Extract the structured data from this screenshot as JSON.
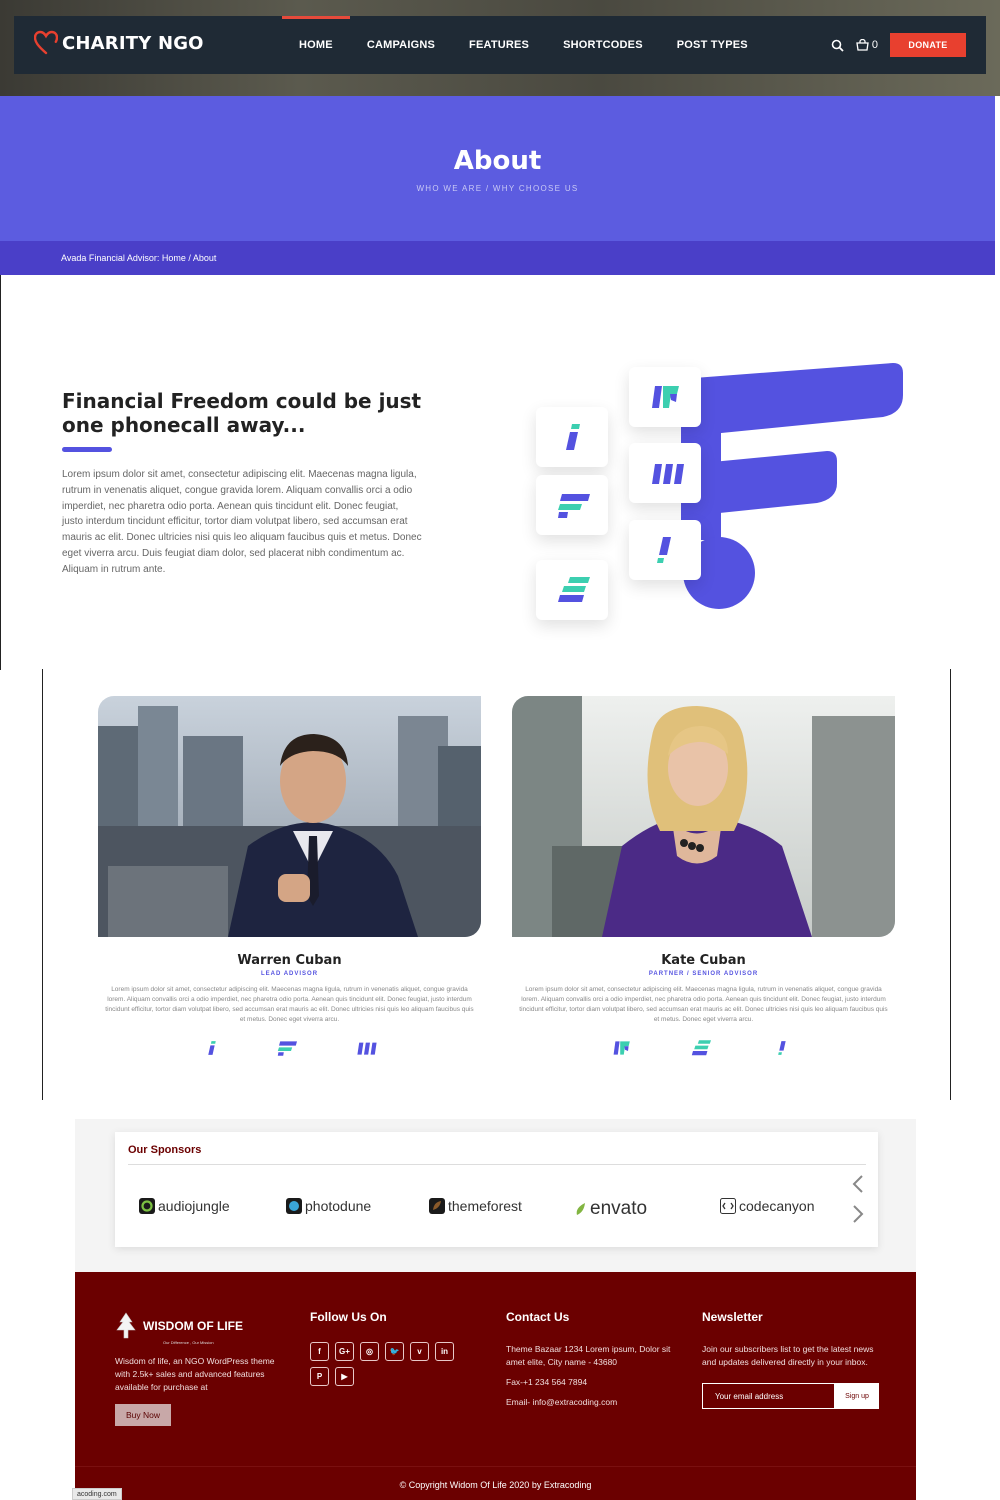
{
  "header": {
    "logo_text": "CHARITY NGO",
    "menu": [
      "HOME",
      "CAMPAIGNS",
      "FEATURES",
      "SHORTCODES",
      "POST TYPES"
    ],
    "cart_count": "0",
    "donate_label": "DONATE"
  },
  "hero": {
    "title": "About",
    "subtitle": "WHO WE ARE / WHY CHOOSE US",
    "breadcrumb": "Avada Financial Advisor: Home  /  About"
  },
  "about": {
    "heading": "Financial Freedom could be just one phonecall away...",
    "body": "Lorem ipsum dolor sit amet, consectetur adipiscing elit. Maecenas magna ligula, rutrum in venenatis aliquet, congue gravida lorem. Aliquam convallis orci a odio imperdiet, nec pharetra odio porta. Aenean quis tincidunt elit. Donec feugiat, justo interdum tincidunt efficitur, tortor diam volutpat libero, sed accumsan erat mauris ac elit. Donec ultricies nisi quis leo aliquam faucibus quis et metus. Donec eget viverra arcu. Duis feugiat diam dolor, sed placerat nibh condimentum ac. Aliquam in rutrum ante."
  },
  "team": [
    {
      "name": "Warren Cuban",
      "role": "LEAD ADVISOR",
      "bio": "Lorem ipsum dolor sit amet, consectetur adipiscing elit. Maecenas magna ligula, rutrum in venenatis aliquet, congue gravida lorem. Aliquam convallis orci a odio imperdiet, nec pharetra odio porta. Aenean quis tincidunt elit. Donec feugiat, justo interdum tincidunt efficitur, tortor diam volutpat libero, sed accumsan erat mauris ac elit. Donec ultricies nisi quis leo aliquam faucibus quis et metus. Donec eget viverra arcu."
    },
    {
      "name": "Kate Cuban",
      "role": "PARTNER / SENIOR ADVISOR",
      "bio": "Lorem ipsum dolor sit amet, consectetur adipiscing elit. Maecenas magna ligula, rutrum in venenatis aliquet, congue gravida lorem. Aliquam convallis orci a odio imperdiet, nec pharetra odio porta. Aenean quis tincidunt elit. Donec feugiat, justo interdum tincidunt efficitur, tortor diam volutpat libero, sed accumsan erat mauris ac elit. Donec ultricies nisi quis leo aliquam faucibus quis et metus. Donec eget viverra arcu."
    }
  ],
  "sponsors": {
    "title": "Our Sponsors",
    "items": [
      "audiojungle",
      "photodune",
      "themeforest",
      "envato",
      "codecanyon"
    ]
  },
  "footer": {
    "brand": "WISDOM OF LIFE",
    "brand_tagline": "Our Difference , Our Mission",
    "about_text": "Wisdom of life, an NGO WordPress theme with 2.5k+ sales and advanced features available for purchase at",
    "buy_label": "Buy Now",
    "follow_title": "Follow Us On",
    "social": [
      "f",
      "G+",
      "◎",
      "🐦",
      "v",
      "in",
      "P",
      "▶"
    ],
    "contact_title": "Contact Us",
    "address": "Theme Bazaar 1234 Lorem ipsum, Dolor sit amet elite, City name - 43680",
    "fax": "Fax-+1 234 564 7894",
    "email": "Email- info@extracoding.com",
    "newsletter_title": "Newsletter",
    "newsletter_text": "Join our subscribers list to get the latest news and updates delivered directly in your inbox.",
    "email_placeholder": "Your email address",
    "signup_label": "Sign up",
    "copyright": "© Copyright Widom Of Life 2020 by Extracoding"
  },
  "status_url": "acoding.com",
  "colors": {
    "nav_bg": "#1f2a35",
    "accent_red": "#e8402f",
    "hero_blue": "#5c5ce0",
    "breadcrumb_blue": "#4a3fc8",
    "footer_maroon": "#6b0000",
    "teal": "#3ccfb0"
  }
}
